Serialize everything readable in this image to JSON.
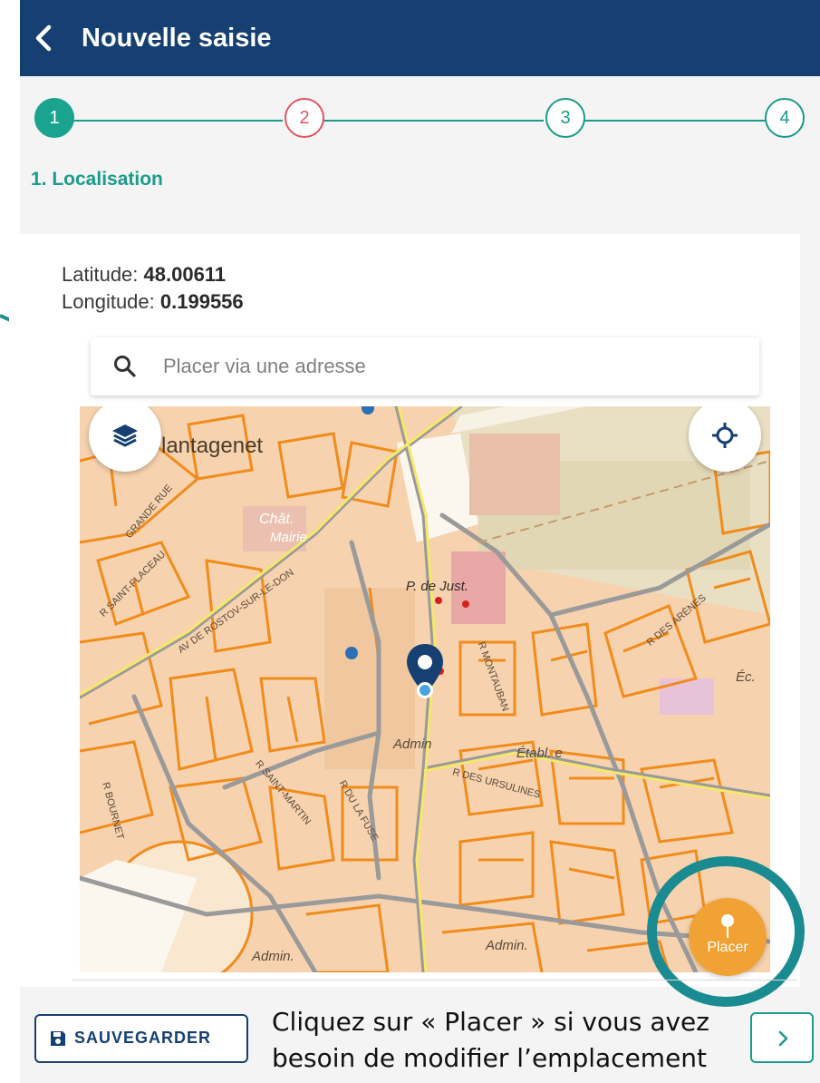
{
  "header": {
    "title": "Nouvelle saisie",
    "back_icon": "chevron-left-icon"
  },
  "stepper": {
    "steps": [
      {
        "label": "1",
        "state": "active"
      },
      {
        "label": "2",
        "state": "error"
      },
      {
        "label": "3",
        "state": "todo"
      },
      {
        "label": "4",
        "state": "todo"
      }
    ]
  },
  "section": {
    "title": "1. Localisation"
  },
  "location": {
    "latitude_label": "Latitude:",
    "latitude_value": "48.00611",
    "longitude_label": "Longitude:",
    "longitude_value": "0.199556"
  },
  "search": {
    "placeholder": "Placer via une adresse",
    "value": "",
    "icon": "search-icon"
  },
  "map": {
    "layers_icon": "layers-icon",
    "locate_icon": "crosshair-icon",
    "labels": {
      "plantagenet": "lantagenet",
      "chat": "Chât.",
      "mairie": "Mairie",
      "pdejust": "P. de Just.",
      "admin1": "Admin",
      "admin2": "Admin.",
      "admin3": "Admin.",
      "etabl": "Établ. e",
      "ec": "Éc.",
      "grande_rue": "GRANDE RUE",
      "st_flaceau": "R SAINT-FLACEAU",
      "rostov": "AV DE ROSTOV-SUR-LE-DON",
      "montauban": "R MONTAUBAN",
      "ursulines": "R DES URSULINES",
      "desarenes": "R DES ARÈNES",
      "st_martin": "R SAINT-MARTIN",
      "ducheverie": "R DU LA FUSE",
      "bournet": "R BOURNET"
    },
    "placer_label": "Placer",
    "placer_icon": "pin-icon"
  },
  "footer": {
    "save_label": "SAUVEGARDER",
    "save_icon": "floppy-disk-icon",
    "next_icon": "chevron-right-icon"
  },
  "annotation": {
    "caption": "Cliquez sur « Placer » si vous avez besoin de modifier l’emplacement"
  },
  "colors": {
    "header_bg": "#163f72",
    "accent": "#1b9b8a",
    "error": "#e05563",
    "placer": "#f0a234"
  }
}
